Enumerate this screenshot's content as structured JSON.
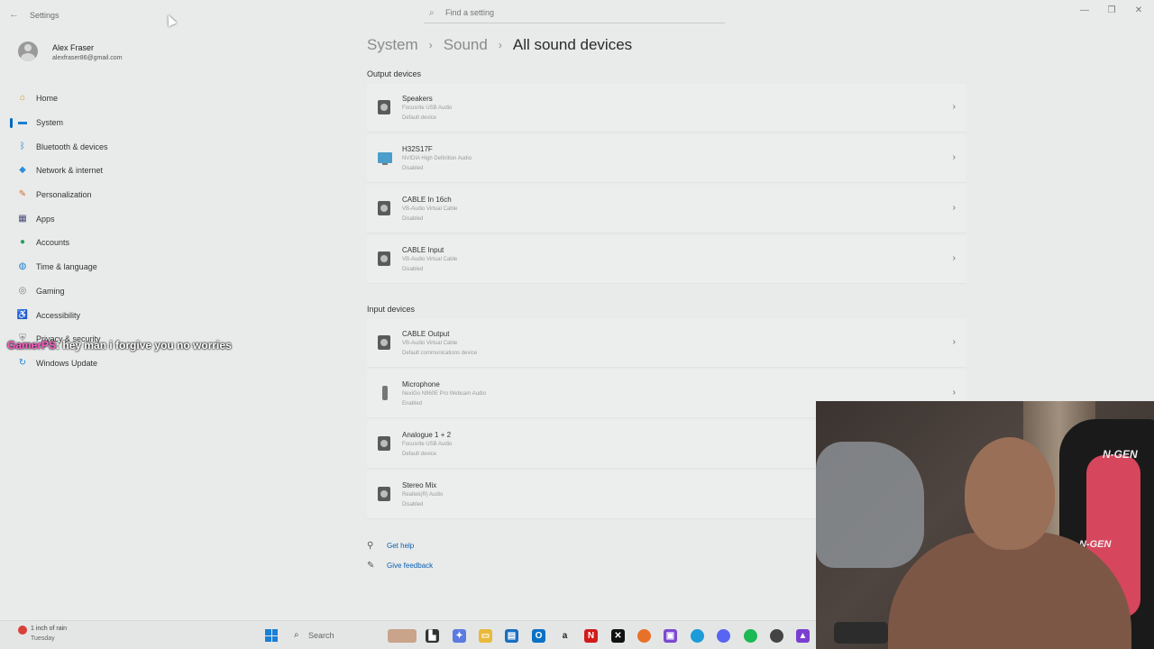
{
  "window": {
    "title": "Settings",
    "search_placeholder": "Find a setting"
  },
  "profile": {
    "name": "Alex Fraser",
    "email": "alexfraser86@gmail.com"
  },
  "nav": {
    "items": [
      {
        "label": "Home",
        "icon": "home-icon",
        "color": "#e08a2e"
      },
      {
        "label": "System",
        "icon": "system-icon",
        "color": "#1e7fd0"
      },
      {
        "label": "Bluetooth & devices",
        "icon": "bluetooth-icon",
        "color": "#1e7fd0"
      },
      {
        "label": "Network & internet",
        "icon": "network-icon",
        "color": "#2d8fdc"
      },
      {
        "label": "Personalization",
        "icon": "brush-icon",
        "color": "#d06f2e"
      },
      {
        "label": "Apps",
        "icon": "apps-icon",
        "color": "#4a4a7a"
      },
      {
        "label": "Accounts",
        "icon": "accounts-icon",
        "color": "#2aa05a"
      },
      {
        "label": "Time & language",
        "icon": "globe-icon",
        "color": "#1e7fd0"
      },
      {
        "label": "Gaming",
        "icon": "gaming-icon",
        "color": "#7a7a7a"
      },
      {
        "label": "Accessibility",
        "icon": "accessibility-icon",
        "color": "#1e6fc0"
      },
      {
        "label": "Privacy & security",
        "icon": "shield-icon",
        "color": "#7a7a7a"
      },
      {
        "label": "Windows Update",
        "icon": "update-icon",
        "color": "#1e7fd0"
      }
    ]
  },
  "chat": {
    "user": "GamerPS",
    "message": ": hey man i forgive you no worries"
  },
  "breadcrumb": {
    "part1": "System",
    "part2": "Sound",
    "current": "All sound devices"
  },
  "output": {
    "label": "Output devices",
    "devices": [
      {
        "name": "Speakers",
        "desc": "Focusrite USB Audio",
        "status": "Default device"
      },
      {
        "name": "H32S17F",
        "desc": "NVIDIA High Definition Audio",
        "status": "Disabled"
      },
      {
        "name": "CABLE In 16ch",
        "desc": "VB-Audio Virtual Cable",
        "status": "Disabled"
      },
      {
        "name": "CABLE Input",
        "desc": "VB-Audio Virtual Cable",
        "status": "Disabled"
      }
    ]
  },
  "input": {
    "label": "Input devices",
    "devices": [
      {
        "name": "CABLE Output",
        "desc": "VB-Audio Virtual Cable",
        "status": "Default communications device"
      },
      {
        "name": "Microphone",
        "desc": "NexiGo N960E Pro Webcam Audio",
        "status": "Enabled"
      },
      {
        "name": "Analogue 1 + 2",
        "desc": "Focusrite USB Audio",
        "status": "Default device"
      },
      {
        "name": "Stereo Mix",
        "desc": "Realtek(R) Audio",
        "status": "Disabled"
      }
    ]
  },
  "links": {
    "help": "Get help",
    "feedback": "Give feedback"
  },
  "webcam": {
    "brand": "N-GEN"
  },
  "taskbar": {
    "weather": "1 inch of rain",
    "day": "Tuesday",
    "search": "Search",
    "amazon_glyph": "a"
  }
}
